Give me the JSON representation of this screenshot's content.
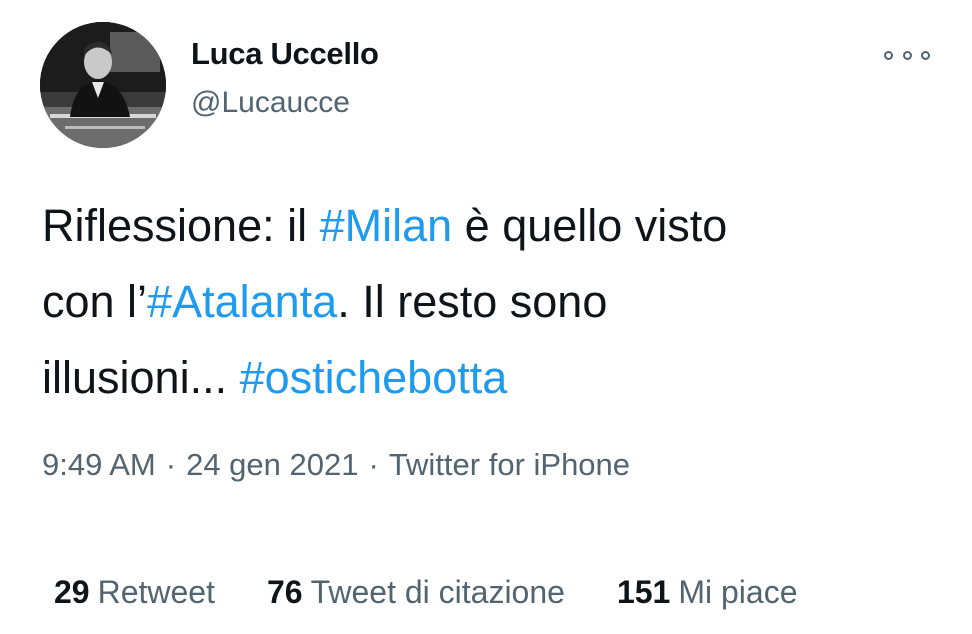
{
  "user": {
    "display_name": "Luca Uccello",
    "handle": "@Lucaucce",
    "avatar_icon": "profile-photo"
  },
  "more_icon": "more-options-icon",
  "tweet": {
    "line1": {
      "pre": "Riflessione: il ",
      "tag": "#Milan",
      "post": " è quello visto"
    },
    "line2": {
      "pre": "con l’",
      "tag": "#Atalanta",
      "post": ". Il resto sono"
    },
    "line3": {
      "pre": "illusioni... ",
      "tag": "#ostichebotta",
      "post": ""
    }
  },
  "meta": {
    "time": "9:49 AM",
    "separator1": "·",
    "date": "24 gen 2021",
    "separator2": "·",
    "source": "Twitter for iPhone"
  },
  "stats": {
    "retweets": {
      "count": "29",
      "label": "Retweet"
    },
    "quotes": {
      "count": "76",
      "label": "Tweet di citazione"
    },
    "likes": {
      "count": "151",
      "label": "Mi piace"
    }
  },
  "colors": {
    "hashtag": "#1d9bf0",
    "secondary_text": "#536471",
    "primary_text": "#0f1419"
  }
}
